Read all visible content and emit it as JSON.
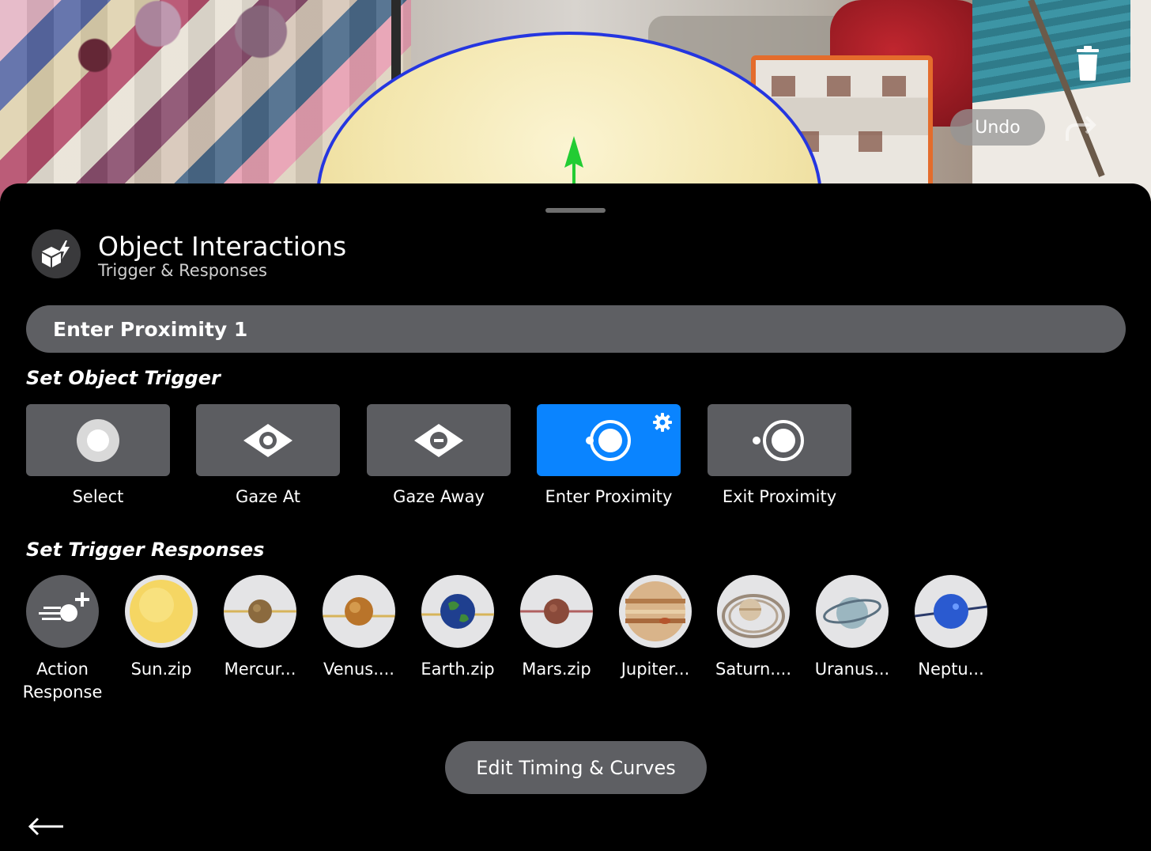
{
  "toolbar": {
    "undo_label": "Undo"
  },
  "header": {
    "title": "Object Interactions",
    "subtitle": "Trigger & Responses"
  },
  "interaction_name": {
    "value": "Enter Proximity 1"
  },
  "triggers": {
    "section_title": "Set Object Trigger",
    "selected": "Enter Proximity",
    "items": [
      {
        "label": "Select",
        "icon": "select-icon"
      },
      {
        "label": "Gaze At",
        "icon": "eye-icon"
      },
      {
        "label": "Gaze Away",
        "icon": "eye-minus-icon"
      },
      {
        "label": "Enter Proximity",
        "icon": "enter-proximity-icon"
      },
      {
        "label": "Exit Proximity",
        "icon": "exit-proximity-icon"
      }
    ]
  },
  "responses": {
    "section_title": "Set Trigger Responses",
    "items": [
      {
        "label": "Action Response",
        "icon": "action-add-icon"
      },
      {
        "label": "Sun.zip",
        "icon": "sun-model"
      },
      {
        "label": "Mercur...",
        "icon": "mercury-model"
      },
      {
        "label": "Venus....",
        "icon": "venus-model"
      },
      {
        "label": "Earth.zip",
        "icon": "earth-model"
      },
      {
        "label": "Mars.zip",
        "icon": "mars-model"
      },
      {
        "label": "Jupiter...",
        "icon": "jupiter-model"
      },
      {
        "label": "Saturn....",
        "icon": "saturn-model"
      },
      {
        "label": "Uranus...",
        "icon": "uranus-model"
      },
      {
        "label": "Neptu...",
        "icon": "neptune-model"
      }
    ]
  },
  "footer": {
    "edit_timing_label": "Edit Timing & Curves"
  },
  "colors": {
    "accent": "#0a84ff",
    "sheet_bg": "#000000",
    "tile_bg": "#5c5d61",
    "field_bg": "#5e5f63",
    "ar_outline": "#2536e0",
    "ar_arrow": "#22cc33"
  }
}
